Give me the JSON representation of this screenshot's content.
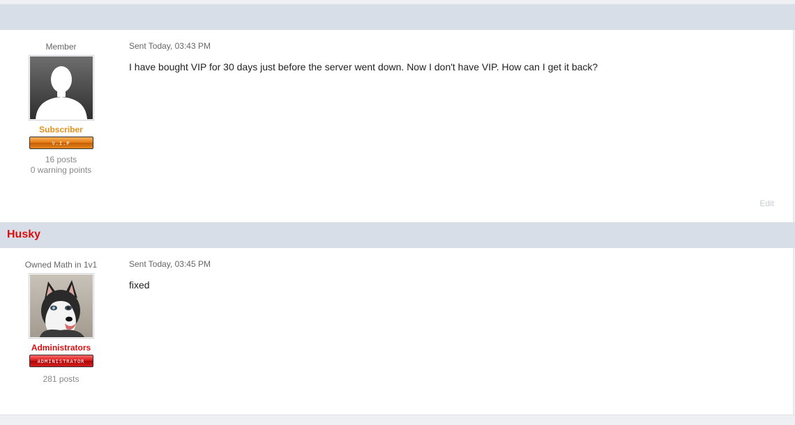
{
  "posts": [
    {
      "author": "",
      "user_title": "Member",
      "group": "Subscriber",
      "group_color": "#e8901b",
      "badge": "V.I.P",
      "posts": "16 posts",
      "warnings": "0 warning points",
      "sent": "Sent Today, 03:43 PM",
      "text": "I have bought VIP for 30 days just before the server went down. Now I don't have VIP. How can I get it back?",
      "edit": "Edit"
    },
    {
      "author": "Husky",
      "user_title": "Owned Math in 1v1",
      "group": "Administrators",
      "group_color": "#d80f0f",
      "badge": "ADMINISTRATOR",
      "posts": "281 posts",
      "sent": "Sent Today, 03:45 PM",
      "text": "fixed"
    }
  ],
  "icons": {
    "avatar_default": "silhouette-avatar-icon",
    "avatar_husky": "husky-avatar-icon"
  }
}
